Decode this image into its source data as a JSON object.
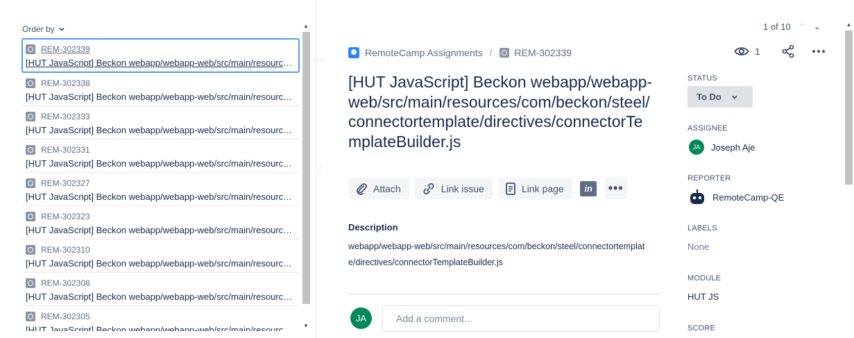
{
  "list": {
    "order_by": "Order by",
    "items": [
      {
        "key": "REM-302339",
        "summary": "[HUT JavaScript] Beckon webapp/webapp-web/src/main/resources/com/beckon/steel/connectortemplate/directives/connectorTemplateBuilder.js"
      },
      {
        "key": "REM-302338",
        "summary": "[HUT JavaScript] Beckon webapp/webapp-web/src/main/resources/com/beckon/steel/connectortemplate/directives/connectorTemplate.js"
      },
      {
        "key": "REM-302333",
        "summary": "[HUT JavaScript] Beckon webapp/webapp-web/src/main/resources/com/beckon/steel/connectortemplate/controllers.js"
      },
      {
        "key": "REM-302331",
        "summary": "[HUT JavaScript] Beckon webapp/webapp-web/src/main/resources/com/beckon/steel/connectortemplate/services.js"
      },
      {
        "key": "REM-302327",
        "summary": "[HUT JavaScript] Beckon webapp/webapp-web/src/main/resources/com/beckon/steel/connectortemplate/module.js"
      },
      {
        "key": "REM-302323",
        "summary": "[HUT JavaScript] Beckon webapp/webapp-web/src/main/resources/com/beckon/steel/connector/directives.js"
      },
      {
        "key": "REM-302310",
        "summary": "[HUT JavaScript] Beckon webapp/webapp-web/src/main/resources/com/beckon/steel/connector/controllers.js"
      },
      {
        "key": "REM-302308",
        "summary": "[HUT JavaScript] Beckon webapp/webapp-web/src/main/resources/com/beckon/steel/connector/services.js"
      },
      {
        "key": "REM-302305",
        "summary": "[HUT JavaScript] Beckon webapp/webapp-web/src/main/resources/com/beckon/steel/connector/module.js"
      }
    ]
  },
  "pager": {
    "text": "1 of 10"
  },
  "breadcrumb": {
    "project": "RemoteCamp Assignments",
    "separator": "/",
    "issue_key": "REM-302339"
  },
  "watchers": {
    "count": "1"
  },
  "issue": {
    "title": "[HUT JavaScript] Beckon webapp/webapp-web/src/main/resources/com/beckon/steel/connectortemplate/directives/connectorTemplateBuilder.js"
  },
  "actions": {
    "attach": "Attach",
    "link_issue": "Link issue",
    "link_page": "Link page",
    "invision": "in",
    "more": "•••"
  },
  "description": {
    "label": "Description",
    "text": "webapp/webapp-web/src/main/resources/com/beckon/steel/connectortemplate/directives/connectorTemplateBuilder.js"
  },
  "comment": {
    "avatar": "JA",
    "placeholder": "Add a comment..."
  },
  "sidebar": {
    "status_label": "STATUS",
    "status_value": "To Do",
    "assignee_label": "ASSIGNEE",
    "assignee_initials": "JA",
    "assignee_name": "Joseph Aje",
    "reporter_label": "REPORTER",
    "reporter_name": "RemoteCamp-QE",
    "labels_label": "LABELS",
    "labels_value": "None",
    "module_label": "MODULE",
    "module_value": "HUT JS",
    "score_label": "SCORE"
  },
  "colors": {
    "accent": "#4c9aff",
    "avatar": "#00875a",
    "project_icon": "#2684ff"
  }
}
